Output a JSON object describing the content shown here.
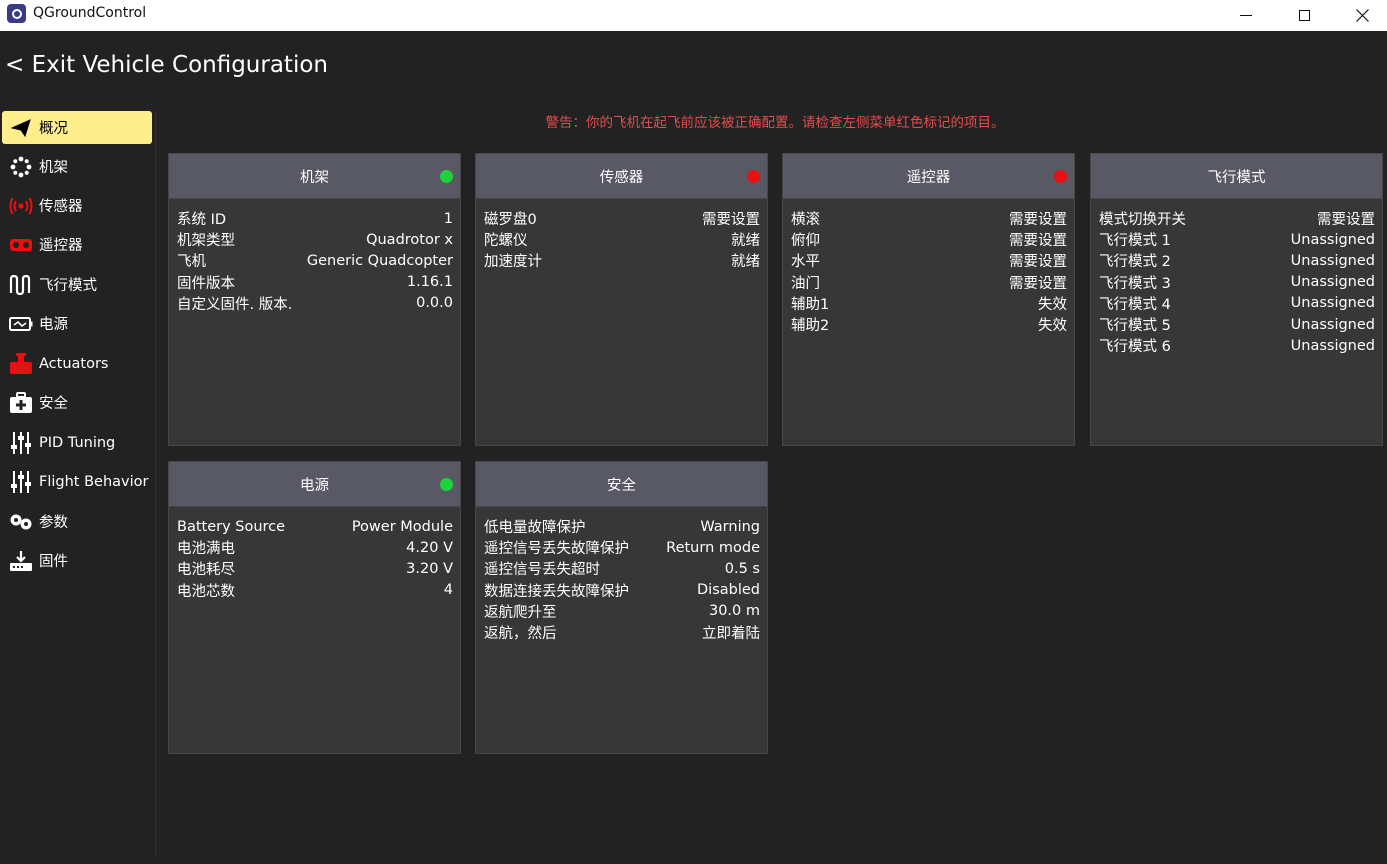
{
  "window": {
    "title": "QGroundControl",
    "controls": [
      "minimize",
      "maximize",
      "close"
    ]
  },
  "header": {
    "exit_label": "< Exit Vehicle Configuration"
  },
  "warning": "警告：你的飞机在起飞前应该被正确配置。请检查左侧菜单红色标记的项目。",
  "sidebar": {
    "items": [
      {
        "label": "概况",
        "icon": "paper-plane-icon",
        "active": true
      },
      {
        "label": "机架",
        "icon": "airframe-icon",
        "active": false
      },
      {
        "label": "传感器",
        "icon": "sensors-icon",
        "active": false,
        "status_color": "#e81010"
      },
      {
        "label": "遥控器",
        "icon": "radio-controller-icon",
        "active": false,
        "status_color": "#e81010"
      },
      {
        "label": "飞行模式",
        "icon": "flight-modes-icon",
        "active": false
      },
      {
        "label": "电源",
        "icon": "battery-icon",
        "active": false
      },
      {
        "label": "Actuators",
        "icon": "actuators-icon",
        "active": false,
        "status_color": "#e81010"
      },
      {
        "label": "安全",
        "icon": "safety-icon",
        "active": false
      },
      {
        "label": "PID Tuning",
        "icon": "sliders-icon",
        "active": false
      },
      {
        "label": "Flight Behavior",
        "icon": "sliders-icon",
        "active": false
      },
      {
        "label": "参数",
        "icon": "gears-icon",
        "active": false
      },
      {
        "label": "固件",
        "icon": "firmware-icon",
        "active": false
      }
    ]
  },
  "cards": [
    {
      "title": "机架",
      "status": "green",
      "rows": [
        [
          "系统 ID",
          "1"
        ],
        [
          "机架类型",
          "Quadrotor x"
        ],
        [
          "飞机",
          "Generic Quadcopter"
        ],
        [
          "固件版本",
          "1.16.1"
        ],
        [
          "自定义固件. 版本.",
          "0.0.0"
        ]
      ]
    },
    {
      "title": "传感器",
      "status": "red",
      "rows": [
        [
          "磁罗盘0",
          "需要设置"
        ],
        [
          "陀螺仪",
          "就绪"
        ],
        [
          "加速度计",
          "就绪"
        ]
      ]
    },
    {
      "title": "遥控器",
      "status": "red",
      "rows": [
        [
          "横滚",
          "需要设置"
        ],
        [
          "俯仰",
          "需要设置"
        ],
        [
          "水平",
          "需要设置"
        ],
        [
          "油门",
          "需要设置"
        ],
        [
          "辅助1",
          "失效"
        ],
        [
          "辅助2",
          "失效"
        ]
      ]
    },
    {
      "title": "飞行模式",
      "status": "",
      "rows": [
        [
          "模式切换开关",
          "需要设置"
        ],
        [
          "飞行模式 1",
          "Unassigned"
        ],
        [
          "飞行模式 2",
          "Unassigned"
        ],
        [
          "飞行模式 3",
          "Unassigned"
        ],
        [
          "飞行模式 4",
          "Unassigned"
        ],
        [
          "飞行模式 5",
          "Unassigned"
        ],
        [
          "飞行模式 6",
          "Unassigned"
        ]
      ]
    },
    {
      "title": "电源",
      "status": "green",
      "rows": [
        [
          "Battery Source",
          "Power Module"
        ],
        [
          "电池满电",
          "4.20 V"
        ],
        [
          "电池耗尽",
          "3.20 V"
        ],
        [
          "电池芯数",
          "4"
        ]
      ]
    },
    {
      "title": "安全",
      "status": "",
      "rows": [
        [
          "低电量故障保护",
          "Warning"
        ],
        [
          "遥控信号丢失故障保护",
          "Return mode"
        ],
        [
          "遥控信号丢失超时",
          "0.5 s"
        ],
        [
          "数据连接丢失故障保护",
          "Disabled"
        ],
        [
          "返航爬升至",
          "30.0 m"
        ],
        [
          "返航，然后",
          "立即着陆"
        ]
      ]
    }
  ],
  "colors": {
    "background": "#222222",
    "card_bg": "#373737",
    "card_header": "#595965",
    "active_nav": "#ffee8c",
    "warning_text": "#e24d4d",
    "status_green": "#1fd23b",
    "status_red": "#e81010"
  }
}
